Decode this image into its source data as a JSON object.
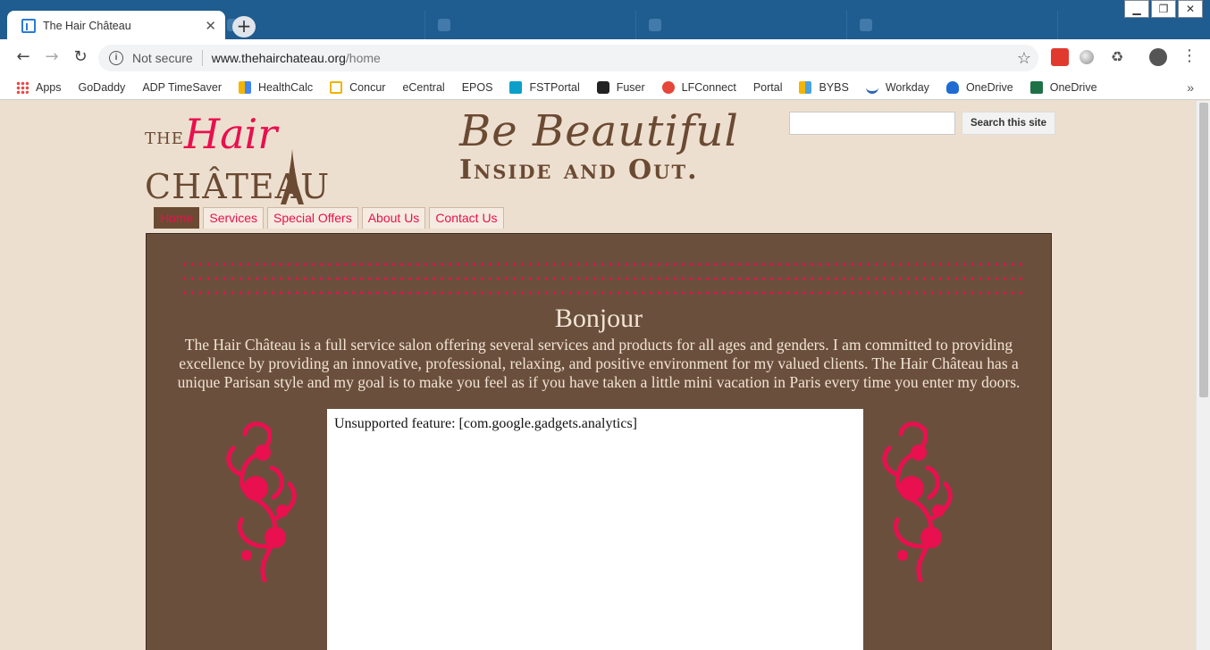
{
  "browser": {
    "tab_title": "The Hair Château",
    "address": {
      "security_label": "Not secure",
      "domain": "www.thehairchateau.org",
      "path": "/home"
    },
    "bookmarks": [
      {
        "label": "Apps",
        "icon": "apps-grid-icon"
      },
      {
        "label": "GoDaddy",
        "icon": "page-icon"
      },
      {
        "label": "ADP TimeSaver",
        "icon": "page-icon"
      },
      {
        "label": "HealthCalc",
        "icon": "healthcalc-icon"
      },
      {
        "label": "Concur",
        "icon": "concur-icon"
      },
      {
        "label": "eCentral",
        "icon": "page-icon"
      },
      {
        "label": "EPOS",
        "icon": "page-icon"
      },
      {
        "label": "FSTPortal",
        "icon": "sharepoint-icon"
      },
      {
        "label": "Fuser",
        "icon": "fuser-icon"
      },
      {
        "label": "LFConnect",
        "icon": "lfconnect-icon"
      },
      {
        "label": "Portal",
        "icon": "page-icon"
      },
      {
        "label": "BYBS",
        "icon": "bybs-icon"
      },
      {
        "label": "Workday",
        "icon": "workday-icon"
      },
      {
        "label": "OneDrive",
        "icon": "onedrive-icon"
      },
      {
        "label": "OneDrive",
        "icon": "excel-icon"
      }
    ]
  },
  "site": {
    "logo": {
      "the": "THE",
      "hair": "Hair",
      "chateau": "CHÂTEAU"
    },
    "tagline": {
      "line1": "Be Beautiful",
      "line2": "Inside and Out."
    },
    "search": {
      "button": "Search this site",
      "value": ""
    },
    "nav": [
      "Home",
      "Services",
      "Special Offers",
      "About Us",
      "Contact Us"
    ],
    "active_nav": "Home",
    "heading": "Bonjour",
    "intro": "The Hair Château is a full service salon offering several services and products for all ages and genders. I am committed to providing excellence by providing an innovative, professional, relaxing, and positive environment for my valued clients.  The Hair Château has a unique Parisan style and my goal is to make you feel as if you have taken a little mini vacation in Paris every time you enter my doors.",
    "gadget_message": "Unsupported feature: [com.google.gadgets.analytics]"
  },
  "colors": {
    "accent_pink": "#e8104e",
    "brown": "#6b4a33",
    "content_bg": "#6b4f3d",
    "page_bg": "#eddfcf"
  }
}
